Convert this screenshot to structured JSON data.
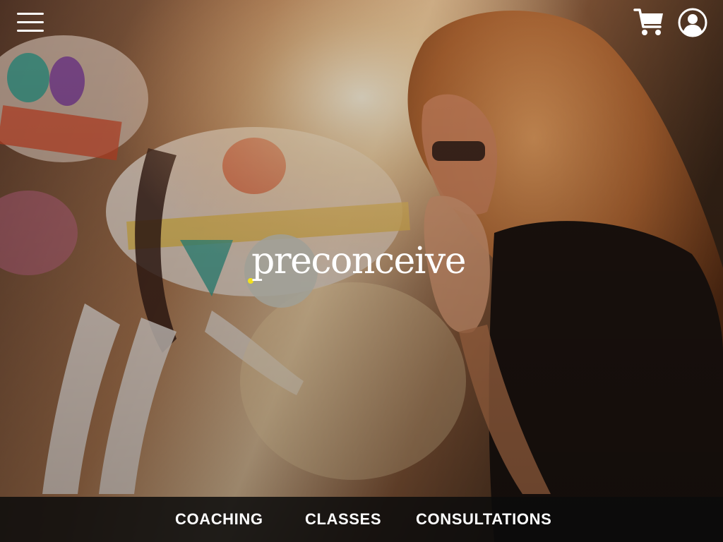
{
  "header": {
    "menu_icon": "hamburger-menu-icon",
    "cart_icon": "shopping-cart-icon",
    "account_icon": "user-account-icon"
  },
  "hero": {
    "image_description_icon": "carousel-photo",
    "logo": {
      "text": "preconceive",
      "dot_color": "#f2e01c",
      "circle_color": "#a0a096"
    }
  },
  "nav": {
    "items": [
      {
        "label": "COACHING"
      },
      {
        "label": "CLASSES"
      },
      {
        "label": "CONSULTATIONS"
      }
    ]
  },
  "colors": {
    "nav_background": "#0c0c0c",
    "text": "#ffffff"
  }
}
